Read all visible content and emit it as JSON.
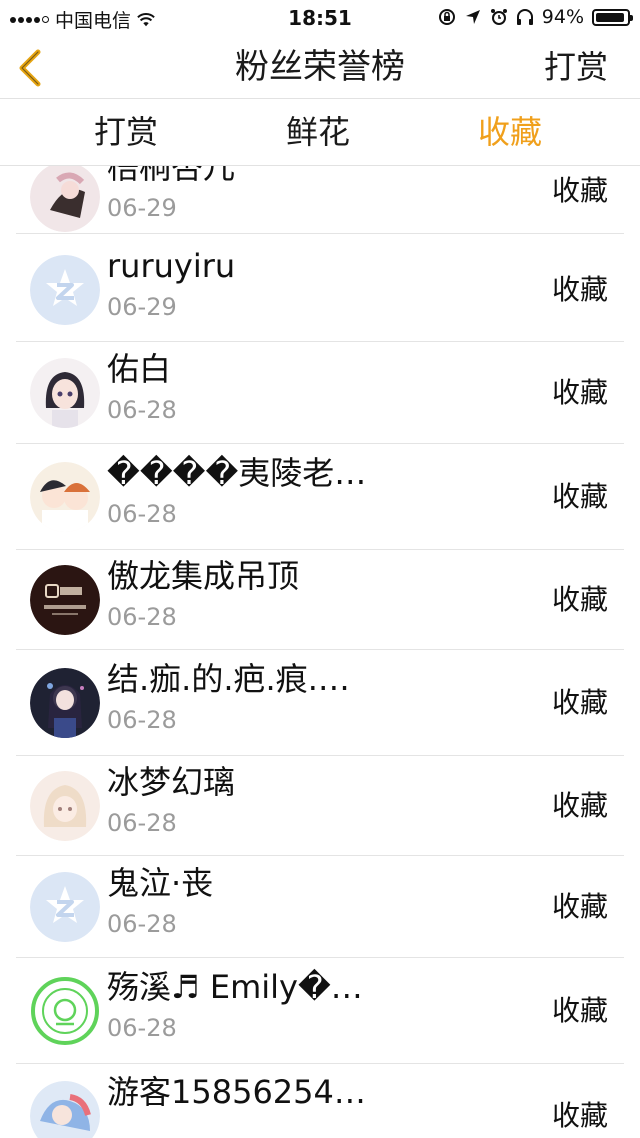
{
  "status_bar": {
    "carrier": "中国电信",
    "time": "18:51",
    "battery": "94%",
    "battery_level": 0.94
  },
  "nav": {
    "back_icon": "chevron-left-icon",
    "title": "粉丝荣誉榜",
    "right_button": "打赏"
  },
  "tabs": [
    {
      "label": "打赏",
      "active": false
    },
    {
      "label": "鲜花",
      "active": false
    },
    {
      "label": "收藏",
      "active": true
    }
  ],
  "colors": {
    "accent": "#f0a01c",
    "date_gray": "#9b9b9b",
    "divider": "#e4e4e4"
  },
  "list": [
    {
      "name": "梧桐杏儿",
      "date": "06-29",
      "action": "收藏",
      "avatar": "avatar-anime-pink"
    },
    {
      "name": "ruruyiru",
      "date": "06-29",
      "action": "收藏",
      "avatar": "avatar-default-z"
    },
    {
      "name": "佑白",
      "date": "06-28",
      "action": "收藏",
      "avatar": "avatar-anime-girl"
    },
    {
      "name": "����夷陵老…",
      "date": "06-28",
      "action": "收藏",
      "avatar": "avatar-anime-duo"
    },
    {
      "name": "傲龙集成吊顶",
      "date": "06-28",
      "action": "收藏",
      "avatar": "avatar-brand-dark"
    },
    {
      "name": "结.痂.的.疤.痕.…",
      "date": "06-28",
      "action": "收藏",
      "avatar": "avatar-anime-dark"
    },
    {
      "name": "冰梦幻璃",
      "date": "06-28",
      "action": "收藏",
      "avatar": "avatar-anime-light"
    },
    {
      "name": "鬼泣·丧",
      "date": "06-28",
      "action": "收藏",
      "avatar": "avatar-default-z"
    },
    {
      "name": "殇溪♬ Emily�…",
      "date": "06-28",
      "action": "收藏",
      "avatar": "avatar-green-stamp"
    },
    {
      "name": "游客15856254…",
      "date": "",
      "action": "收藏",
      "avatar": "avatar-anime-colorful"
    }
  ]
}
